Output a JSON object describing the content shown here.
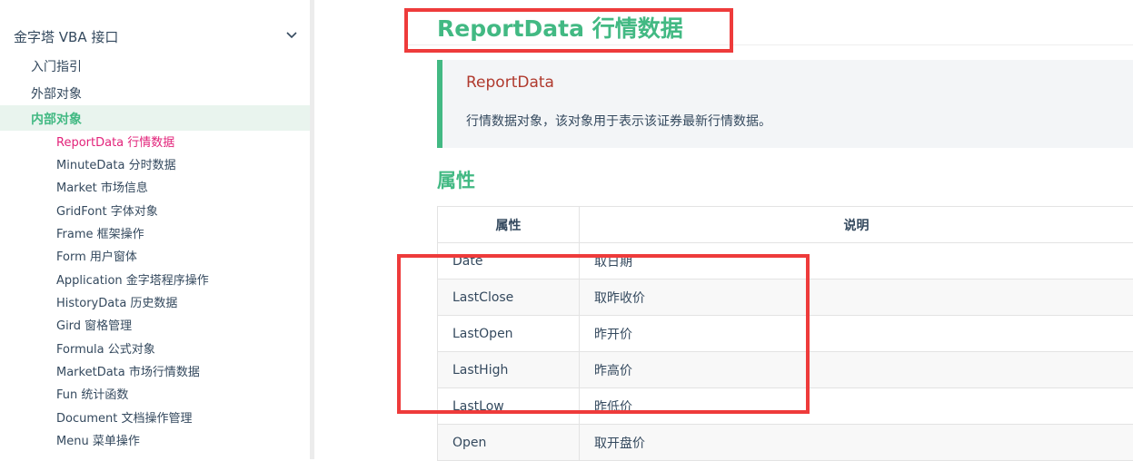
{
  "sidebar": {
    "section_title": "金字塔 VBA 接口",
    "items": [
      {
        "label": "入门指引"
      },
      {
        "label": "外部对象"
      },
      {
        "label": "内部对象"
      }
    ],
    "sub_items": [
      {
        "label": "ReportData 行情数据"
      },
      {
        "label": "MinuteData 分时数据"
      },
      {
        "label": "Market 市场信息"
      },
      {
        "label": "GridFont 字体对象"
      },
      {
        "label": "Frame 框架操作"
      },
      {
        "label": "Form 用户窗体"
      },
      {
        "label": "Application 金字塔程序操作"
      },
      {
        "label": "HistoryData 历史数据"
      },
      {
        "label": "Gird 窗格管理"
      },
      {
        "label": "Formula 公式对象"
      },
      {
        "label": "MarketData 市场行情数据"
      },
      {
        "label": "Fun 统计函数"
      },
      {
        "label": "Document 文档操作管理"
      },
      {
        "label": "Menu 菜单操作"
      }
    ]
  },
  "main": {
    "title": "ReportData 行情数据",
    "note": {
      "title": "ReportData",
      "text": "行情数据对象，该对象用于表示该证券最新行情数据。"
    },
    "section_heading": "属性",
    "table": {
      "headers": [
        "属性",
        "说明"
      ],
      "rows": [
        [
          "Date",
          "取日期"
        ],
        [
          "LastClose",
          "取昨收价"
        ],
        [
          "LastOpen",
          "昨开价"
        ],
        [
          "LastHigh",
          "昨高价"
        ],
        [
          "LastLow",
          "昨低价"
        ],
        [
          "Open",
          "取开盘价"
        ]
      ]
    }
  },
  "colors": {
    "accent": "#42b983",
    "active_link": "#e2237a",
    "annotation": "#ee3b3b"
  }
}
